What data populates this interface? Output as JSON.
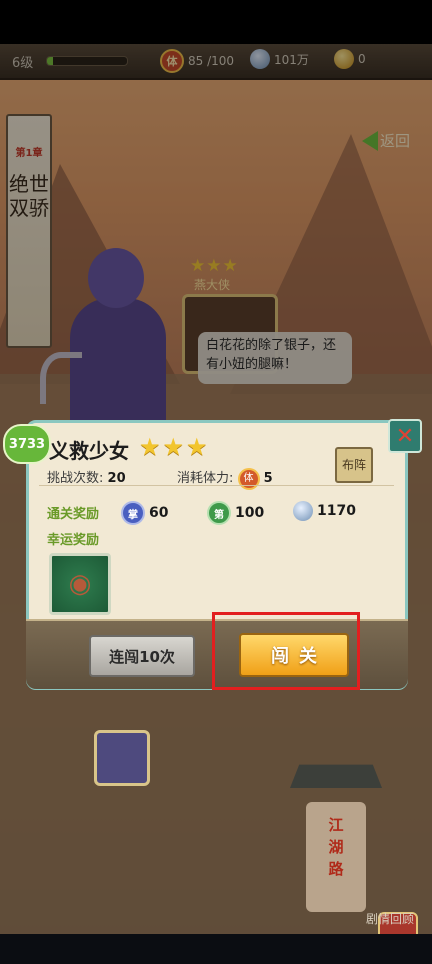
{
  "status_bar": {
    "level": "6级",
    "xp_progress": 0.08,
    "stamina": "85 /100",
    "silver": "101万",
    "gold": "0",
    "stamina_icon_text": "体"
  },
  "chapter": {
    "tag": "第1章",
    "name": "绝世双骄"
  },
  "nav": {
    "back_label": "返回"
  },
  "enemy": {
    "stars": "★★★",
    "name": "燕大侠"
  },
  "speech_bubble": "白花花的除了银子，还有小妞的腿嘛！",
  "stage_popup": {
    "score_badge": "3733",
    "title": "义救少女",
    "stars": "★★★",
    "formation_label": "布阵",
    "close_label": "✕",
    "challenge_count_label": "挑战次数:",
    "challenge_count_value": "20",
    "stamina_cost_label": "消耗体力:",
    "stamina_cost_value": "5",
    "stamina_icon_text": "体",
    "clear_reward_label": "通关奖励",
    "rewards": [
      {
        "icon": "medal-blue-icon",
        "glyph": "掌",
        "value": "60"
      },
      {
        "icon": "medal-green-icon",
        "glyph": "第",
        "value": "100"
      },
      {
        "icon": "silver-icon",
        "glyph": "",
        "value": "1170"
      }
    ],
    "lucky_reward_label": "幸运奖励",
    "lucky_item_icon": "mushroom-icon",
    "sweep_button": "连闯10次",
    "challenge_button": "闯关"
  },
  "map": {
    "tower_text": "江湖路",
    "review_label": "剧情回顾"
  },
  "colors": {
    "highlight": "#e21f1f",
    "accent_green": "#6a9a28",
    "gold_button": "#f0a017"
  }
}
